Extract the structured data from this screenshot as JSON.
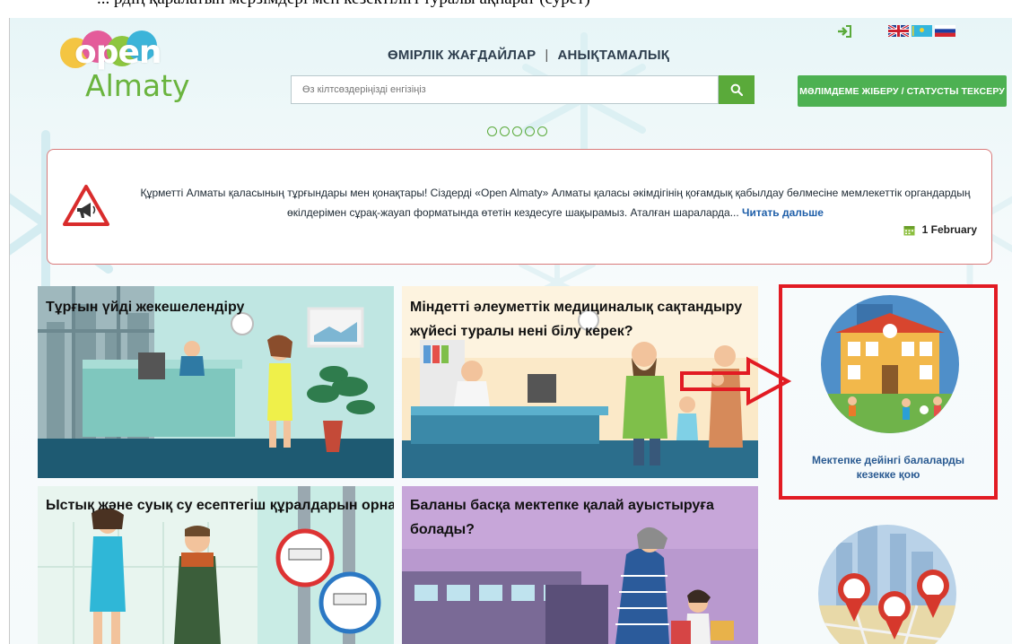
{
  "doc_strip": "... рдің қаралатын мерзімдері мен кезектілігі туралы ақпарат (сурет)",
  "header": {
    "logo_open": "open",
    "logo_almaty": "Almaty",
    "nav": [
      "ӨМІРЛІК ЖАҒДАЙЛАР",
      "АНЫҚТАМАЛЫҚ"
    ],
    "nav_separator": "|",
    "search_placeholder": "Өз кілтсөздеріңізді енгізіңіз",
    "apply_button": "МӘЛІМДЕМЕ ЖІБЕРУ / СТАТУСТЫ ТЕКСЕРУ",
    "languages": [
      "en",
      "kz",
      "ru"
    ]
  },
  "slider": {
    "dots": 5,
    "active": 0
  },
  "notice": {
    "text": "Құрметті Алматы қаласының тұрғындары мен қонақтары! Сіздерді «Open Almaty» Алматы қаласы әкімдігінің қоғамдық қабылдау бөлмесіне мемлекеттік органдардың өкілдерімен сұрақ-жауап форматында өтетін кездесуге шақырамыз. Аталған шараларда...",
    "read_more": "Читать дальше",
    "date": "1 February"
  },
  "tiles": [
    {
      "title": "Тұрғын үйді жекешелендіру"
    },
    {
      "title_line1": "Міндетті әлеуметтік медициналық сақтандыру",
      "title_line2": "жүйесі туралы нені білу керек?"
    },
    {
      "title": "Ыстық және суық су есептегіш құралдарын орнату"
    },
    {
      "title_line1": "Баланы басқа мектепке қалай ауыстыруға",
      "title_line2": "болады?"
    }
  ],
  "side_cards": [
    {
      "label_line1": "Мектепке дейінгі балаларды",
      "label_line2": "кезекке қою"
    },
    {
      "label_line1": "",
      "label_line2": ""
    }
  ],
  "colors": {
    "accent_green": "#5aaa3a",
    "highlight_red": "#e21b23",
    "link_blue": "#1f5fa9"
  }
}
